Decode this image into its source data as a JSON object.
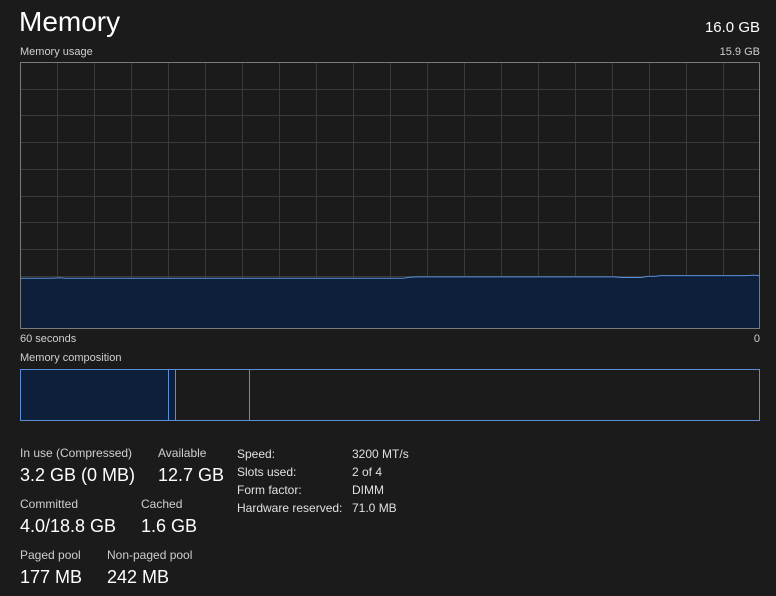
{
  "header": {
    "title": "Memory",
    "total": "16.0 GB"
  },
  "usage_graph": {
    "label": "Memory usage",
    "max_label": "15.9 GB",
    "time_label": "60 seconds",
    "zero_label": "0",
    "fill_fraction": [
      0.19,
      0.19,
      0.19,
      0.19,
      0.19,
      0.19,
      0.192,
      0.19,
      0.19,
      0.19,
      0.19,
      0.19,
      0.19,
      0.19,
      0.19,
      0.19,
      0.19,
      0.19,
      0.19,
      0.19,
      0.19,
      0.19,
      0.19,
      0.19,
      0.19,
      0.19,
      0.19,
      0.19,
      0.19,
      0.19,
      0.19,
      0.19,
      0.19,
      0.19,
      0.19,
      0.19,
      0.19,
      0.19,
      0.19,
      0.19,
      0.19,
      0.19,
      0.19,
      0.19,
      0.19,
      0.19,
      0.19,
      0.19,
      0.19,
      0.19,
      0.19,
      0.19,
      0.19,
      0.19,
      0.19,
      0.19,
      0.19,
      0.19,
      0.19,
      0.194,
      0.195,
      0.195,
      0.195,
      0.195,
      0.195,
      0.195,
      0.195,
      0.195,
      0.195,
      0.195,
      0.195,
      0.195,
      0.195,
      0.195,
      0.195,
      0.195,
      0.195,
      0.195,
      0.195,
      0.195,
      0.195,
      0.195,
      0.195,
      0.195,
      0.195,
      0.195,
      0.195,
      0.195,
      0.195,
      0.195,
      0.195,
      0.193,
      0.193,
      0.193,
      0.193,
      0.197,
      0.197,
      0.2,
      0.2,
      0.2,
      0.2,
      0.2,
      0.2,
      0.2,
      0.2,
      0.2,
      0.2,
      0.2,
      0.2,
      0.2,
      0.2,
      0.202,
      0.2
    ],
    "line_color": "#5a8fd8",
    "fill_color": "#0d1f3a",
    "grid_color": "#3a3a3a",
    "border_color": "#7a7a7a"
  },
  "composition": {
    "label": "Memory composition",
    "in_use_fraction": 0.2,
    "modified_fraction": 0.01,
    "standby_fraction": 0.1,
    "free_fraction": 0.69,
    "fill_color": "#0d1f3a",
    "border_color": "#5a8fd8"
  },
  "stats": {
    "in_use_label": "In use (Compressed)",
    "in_use_value": "3.2 GB (0 MB)",
    "available_label": "Available",
    "available_value": "12.7 GB",
    "committed_label": "Committed",
    "committed_value": "4.0/18.8 GB",
    "cached_label": "Cached",
    "cached_value": "1.6 GB",
    "paged_label": "Paged pool",
    "paged_value": "177 MB",
    "nonpaged_label": "Non-paged pool",
    "nonpaged_value": "242 MB"
  },
  "specs": {
    "speed_label": "Speed:",
    "speed_value": "3200 MT/s",
    "slots_label": "Slots used:",
    "slots_value": "2 of 4",
    "form_label": "Form factor:",
    "form_value": "DIMM",
    "reserved_label": "Hardware reserved:",
    "reserved_value": "71.0 MB"
  }
}
